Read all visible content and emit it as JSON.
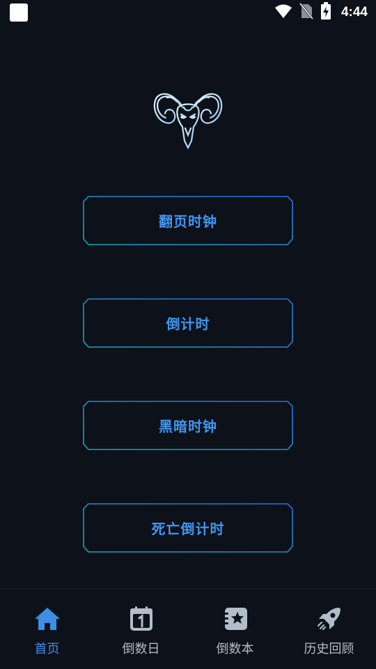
{
  "status_bar": {
    "time": "4:44",
    "icons": [
      "app-notification-square",
      "wifi-icon",
      "no-sim-icon",
      "battery-charging-icon"
    ]
  },
  "logo": {
    "icon": "ram-skull-icon"
  },
  "menu": {
    "buttons": [
      {
        "label": "翻页时钟"
      },
      {
        "label": "倒计时"
      },
      {
        "label": "黑暗时钟"
      },
      {
        "label": "死亡倒计时"
      }
    ]
  },
  "bottom_nav": {
    "items": [
      {
        "label": "首页",
        "icon": "home-icon",
        "active": true
      },
      {
        "label": "倒数日",
        "icon": "calendar-icon",
        "active": false
      },
      {
        "label": "倒数本",
        "icon": "notebook-star-icon",
        "active": false
      },
      {
        "label": "历史回顾",
        "icon": "rocket-icon",
        "active": false
      }
    ]
  },
  "colors": {
    "background": "#0d1119",
    "accent": "#3f97f0",
    "nav_inactive": "#b3bccb",
    "border_gradient_start": "#17a6b8",
    "border_gradient_end": "#2d6de0"
  }
}
